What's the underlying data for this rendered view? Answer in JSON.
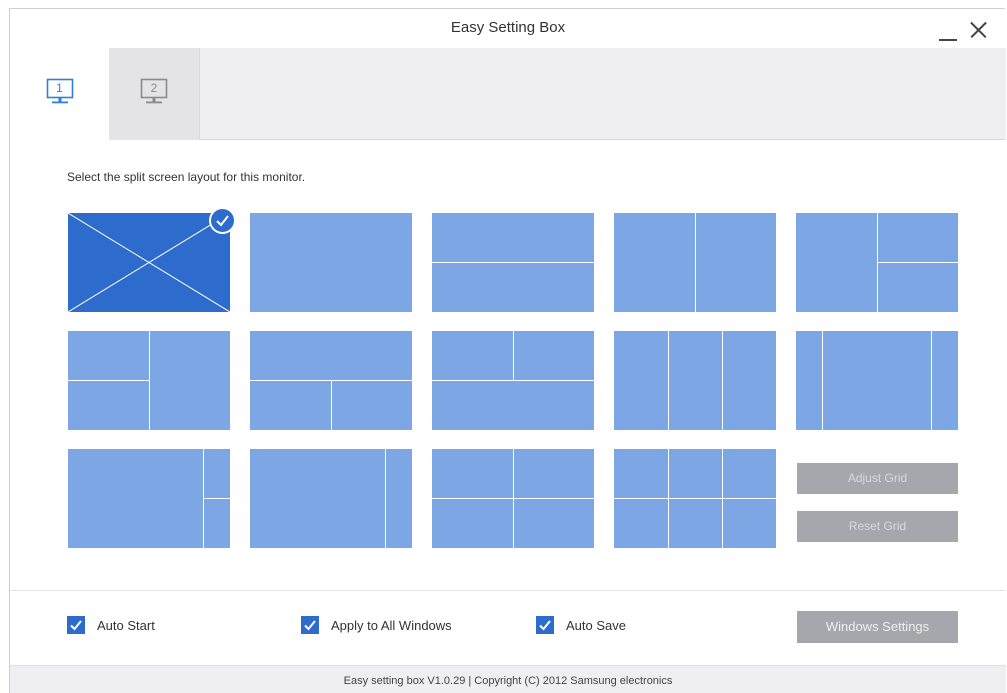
{
  "window": {
    "title": "Easy Setting Box"
  },
  "tabs": [
    {
      "label": "1",
      "icon": "monitor-icon",
      "selected": true
    },
    {
      "label": "2",
      "icon": "monitor-icon",
      "selected": false
    }
  ],
  "instruction": "Select the split screen layout for this monitor.",
  "layouts": [
    {
      "id": "off",
      "selected": true
    },
    {
      "id": "full"
    },
    {
      "id": "two-rows"
    },
    {
      "id": "two-columns"
    },
    {
      "id": "left-plus-right-stacked"
    },
    {
      "id": "left-stacked-plus-right"
    },
    {
      "id": "top-plus-bottom-split"
    },
    {
      "id": "top-split-plus-bottom"
    },
    {
      "id": "three-columns"
    },
    {
      "id": "narrow-wide-narrow"
    },
    {
      "id": "wide-plus-right-stacked"
    },
    {
      "id": "wide-plus-narrow-right"
    },
    {
      "id": "quad"
    },
    {
      "id": "three-by-two"
    }
  ],
  "side_buttons": {
    "adjust_grid": "Adjust Grid",
    "reset_grid": "Reset Grid"
  },
  "options": [
    {
      "label": "Auto Start",
      "checked": true
    },
    {
      "label": "Apply to All Windows",
      "checked": true
    },
    {
      "label": "Auto Save",
      "checked": true
    }
  ],
  "windows_settings": "Windows Settings",
  "footer": "Easy setting box V1.0.29 | Copyright (C) 2012 Samsung electronics",
  "colors": {
    "accent": "#2d6bcc",
    "tile": "#7ca6e4",
    "disabled_button": "#a5a7ad",
    "tab_active_icon": "#2f80d6"
  }
}
